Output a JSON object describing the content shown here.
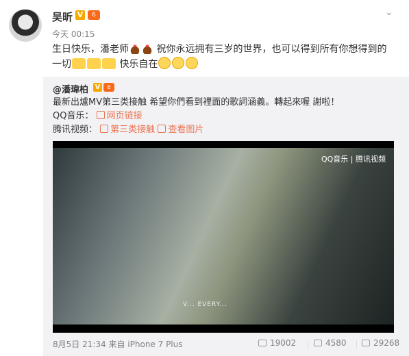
{
  "post": {
    "username": "吴昕",
    "verified_mark": "V",
    "vip_mark": "6",
    "time": "今天 00:15",
    "text_line1_part1": "生日快乐，潘老师",
    "text_line1_part2": "祝你永远拥有三岁的世界，也可以得到所有你想得到的",
    "text_line2_part1": "一切",
    "text_line2_part2": "快乐自在"
  },
  "repost": {
    "username": "@潘瑋柏",
    "verified_mark": "V",
    "vip_mark": "6",
    "text": "最新出爐MV第三类接触 希望你們看到裡面的歌詞涵義。轉起來喔 謝啦！",
    "qq_music_label": "QQ音乐：",
    "web_link_label": "网页链接",
    "tencent_video_label": "腾讯视频：",
    "video_link_label": "第三类接触",
    "view_image_label": "查看图片",
    "video": {
      "watermark": "QQ音乐 | 腾讯视频",
      "caption": "V... EVERY..."
    },
    "footer_time": "8月5日 21:34 来自 iPhone 7 Plus",
    "reposts": "19002",
    "comments": "4580",
    "likes": "29268"
  },
  "icons": {
    "menu": "chevron-down-icon",
    "repost": "repost-icon",
    "comment": "comment-icon",
    "like": "like-icon"
  }
}
